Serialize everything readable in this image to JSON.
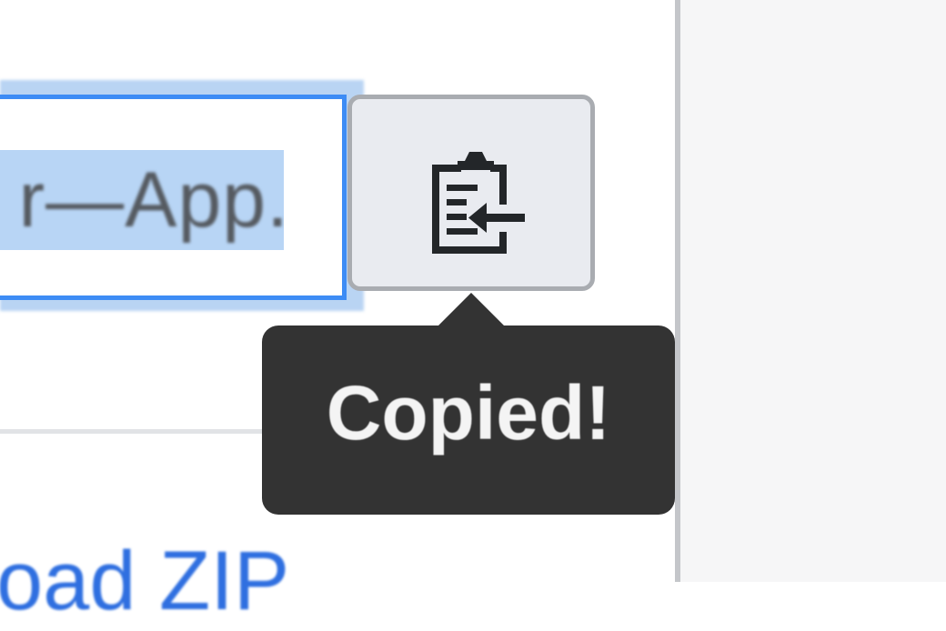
{
  "clone": {
    "url_visible": "r—App.",
    "copy_button": {
      "icon": "clipboard-copy-icon",
      "tooltip": "Copied!"
    }
  },
  "download": {
    "label_visible": "oad ZIP"
  },
  "colors": {
    "focus_ring": "#3d8cf5",
    "selection": "#b8d5f5",
    "tooltip_bg": "#333333",
    "link": "#2f6fe0"
  }
}
